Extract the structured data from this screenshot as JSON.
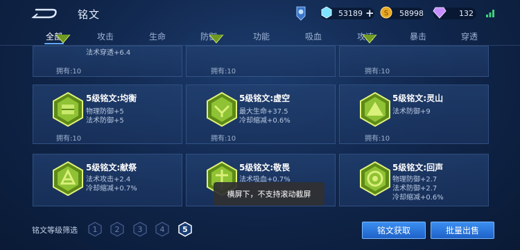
{
  "header": {
    "title": "铭文",
    "resources": [
      {
        "icon": "diamond-icon",
        "value": "53189",
        "plus": "+"
      },
      {
        "icon": "gold-coin-icon",
        "value": "58998"
      },
      {
        "icon": "gem-icon",
        "value": "132"
      }
    ]
  },
  "tabs": [
    "全部",
    "攻击",
    "生命",
    "防御",
    "功能",
    "吸血",
    "攻速",
    "暴击",
    "穿透"
  ],
  "partial_cards": [
    {
      "stat": "法术穿透+6.4",
      "owned": "拥有:10"
    },
    {
      "owned": "拥有:10"
    },
    {
      "owned": "拥有:10"
    }
  ],
  "cards": [
    {
      "title": "5级铭文:均衡",
      "stats": [
        "物理防御+5",
        "法术防御+5"
      ],
      "owned": "拥有:10"
    },
    {
      "title": "5级铭文:虚空",
      "stats": [
        "最大生命+37.5",
        "冷却缩减+0.6%"
      ],
      "owned": "拥有:10"
    },
    {
      "title": "5级铭文:灵山",
      "stats": [
        "法术防御+9"
      ],
      "owned": "拥有:10"
    },
    {
      "title": "5级铭文:献祭",
      "stats": [
        "法术攻击+2.4",
        "冷却缩减+0.7%"
      ]
    },
    {
      "title": "5级铭文:敬畏",
      "stats": [
        "法术吸血+0.7%"
      ]
    },
    {
      "title": "5级铭文:回声",
      "stats": [
        "物理防御+2.7",
        "法术防御+2.7",
        "冷却缩减+0.6%"
      ]
    }
  ],
  "filter": {
    "label": "铭文等级筛选",
    "levels": [
      "1",
      "2",
      "3",
      "4",
      "5"
    ],
    "selected": "5"
  },
  "buttons": {
    "get": "铭文获取",
    "sell": "批量出售"
  },
  "toast": "横屏下，不支持滚动截屏",
  "colors": {
    "accent": "#3b8ef0",
    "gem": "#9fcf3a",
    "background": "#13305c"
  }
}
